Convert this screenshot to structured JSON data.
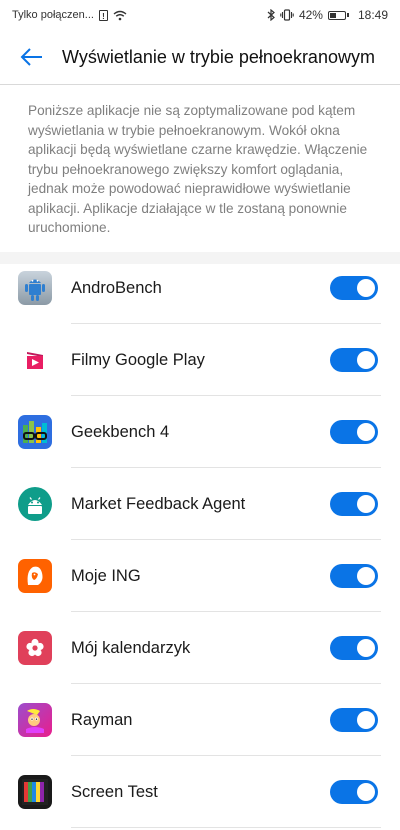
{
  "status_bar": {
    "carrier": "Tylko połączen...",
    "battery": "42%",
    "time": "18:49"
  },
  "header": {
    "title": "Wyświetlanie w trybie pełnoekranowym"
  },
  "description": "Poniższe aplikacje nie są zoptymalizowane pod kątem wyświetlania w trybie pełnoekranowym. Wokół okna aplikacji będą wyświetlane czarne krawędzie. Włączenie trybu pełnoekranowego zwiększy komfort oglądania, jednak może powodować nieprawidłowe wyświetlanie aplikacji. Aplikacje działające w tle zostaną ponownie uruchomione.",
  "apps": [
    {
      "name": "AndroBench",
      "enabled": true
    },
    {
      "name": "Filmy Google Play",
      "enabled": true
    },
    {
      "name": "Geekbench 4",
      "enabled": true
    },
    {
      "name": "Market Feedback Agent",
      "enabled": true
    },
    {
      "name": "Moje ING",
      "enabled": true
    },
    {
      "name": "Mój kalendarzyk",
      "enabled": true
    },
    {
      "name": "Rayman",
      "enabled": true
    },
    {
      "name": "Screen Test",
      "enabled": true
    }
  ],
  "colors": {
    "accent": "#0a74e6",
    "description_text": "#7f7f7f"
  }
}
